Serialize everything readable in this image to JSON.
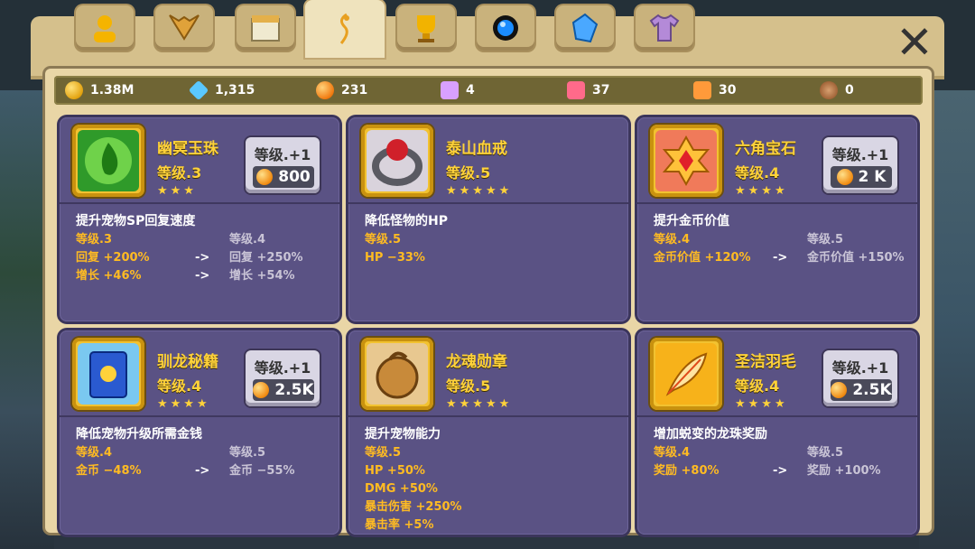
{
  "resources": [
    {
      "icon": "gold-coin-icon",
      "value": "1.38M"
    },
    {
      "icon": "diamond-icon",
      "value": "1,315"
    },
    {
      "icon": "orange-orb-icon",
      "value": "231"
    },
    {
      "icon": "star-badge-icon",
      "value": "4"
    },
    {
      "icon": "pink-badge-icon",
      "value": "37"
    },
    {
      "icon": "orange-badge-icon",
      "value": "30"
    },
    {
      "icon": "bronze-token-icon",
      "value": "0"
    }
  ],
  "tabs": [
    "profile-tab-icon",
    "dragon-tab-icon",
    "shop-tab-icon",
    "relic-tab-icon",
    "trophy-tab-icon",
    "orb-tab-icon",
    "crystal-tab-icon",
    "shirt-tab-icon"
  ],
  "close_label": "✕",
  "cards": [
    {
      "name": "幽冥玉珠",
      "level": "等级.3",
      "stars": "★★★",
      "upgrade_label": "等级.+1",
      "cost": "800",
      "desc": "提升宠物SP回复速度",
      "current": [
        "等级.3",
        "回复 +200%",
        "增长 +46%"
      ],
      "arrows": [
        "",
        "->",
        "->"
      ],
      "next": [
        "等级.4",
        "回复 +250%",
        "增长 +54%"
      ]
    },
    {
      "name": "泰山血戒",
      "level": "等级.5",
      "stars": "★★★★★",
      "upgrade_label": "",
      "cost": "",
      "desc": "降低怪物的HP",
      "current": [
        "等级.5",
        "HP −33%"
      ],
      "arrows": [],
      "next": []
    },
    {
      "name": "六角宝石",
      "level": "等级.4",
      "stars": "★★★★",
      "upgrade_label": "等级.+1",
      "cost": "2 K",
      "desc": "提升金币价值",
      "current": [
        "等级.4",
        "金币价值 +120%"
      ],
      "arrows": [
        "",
        "->"
      ],
      "next": [
        "等级.5",
        "金币价值 +150%"
      ]
    },
    {
      "name": "驯龙秘籍",
      "level": "等级.4",
      "stars": "★★★★",
      "upgrade_label": "等级.+1",
      "cost": "2.5K",
      "desc": "降低宠物升级所需金钱",
      "current": [
        "等级.4",
        "金币 −48%"
      ],
      "arrows": [
        "",
        "->"
      ],
      "next": [
        "等级.5",
        "金币 −55%"
      ]
    },
    {
      "name": "龙魂勋章",
      "level": "等级.5",
      "stars": "★★★★★",
      "upgrade_label": "",
      "cost": "",
      "desc": "提升宠物能力",
      "current": [
        "等级.5",
        "HP +50%",
        "DMG +50%",
        "暴击伤害 +250%",
        "暴击率 +5%"
      ],
      "arrows": [],
      "next": []
    },
    {
      "name": "圣洁羽毛",
      "level": "等级.4",
      "stars": "★★★★",
      "upgrade_label": "等级.+1",
      "cost": "2.5K",
      "desc": "增加蜕变的龙珠奖励",
      "current": [
        "等级.4",
        "奖励 +80%"
      ],
      "arrows": [
        "",
        "->"
      ],
      "next": [
        "等级.5",
        "奖励 +100%"
      ]
    }
  ],
  "colors": {
    "gold_text": "#ffd23a",
    "card_bg": "#5a5284",
    "panel": "#e9d6a6"
  }
}
